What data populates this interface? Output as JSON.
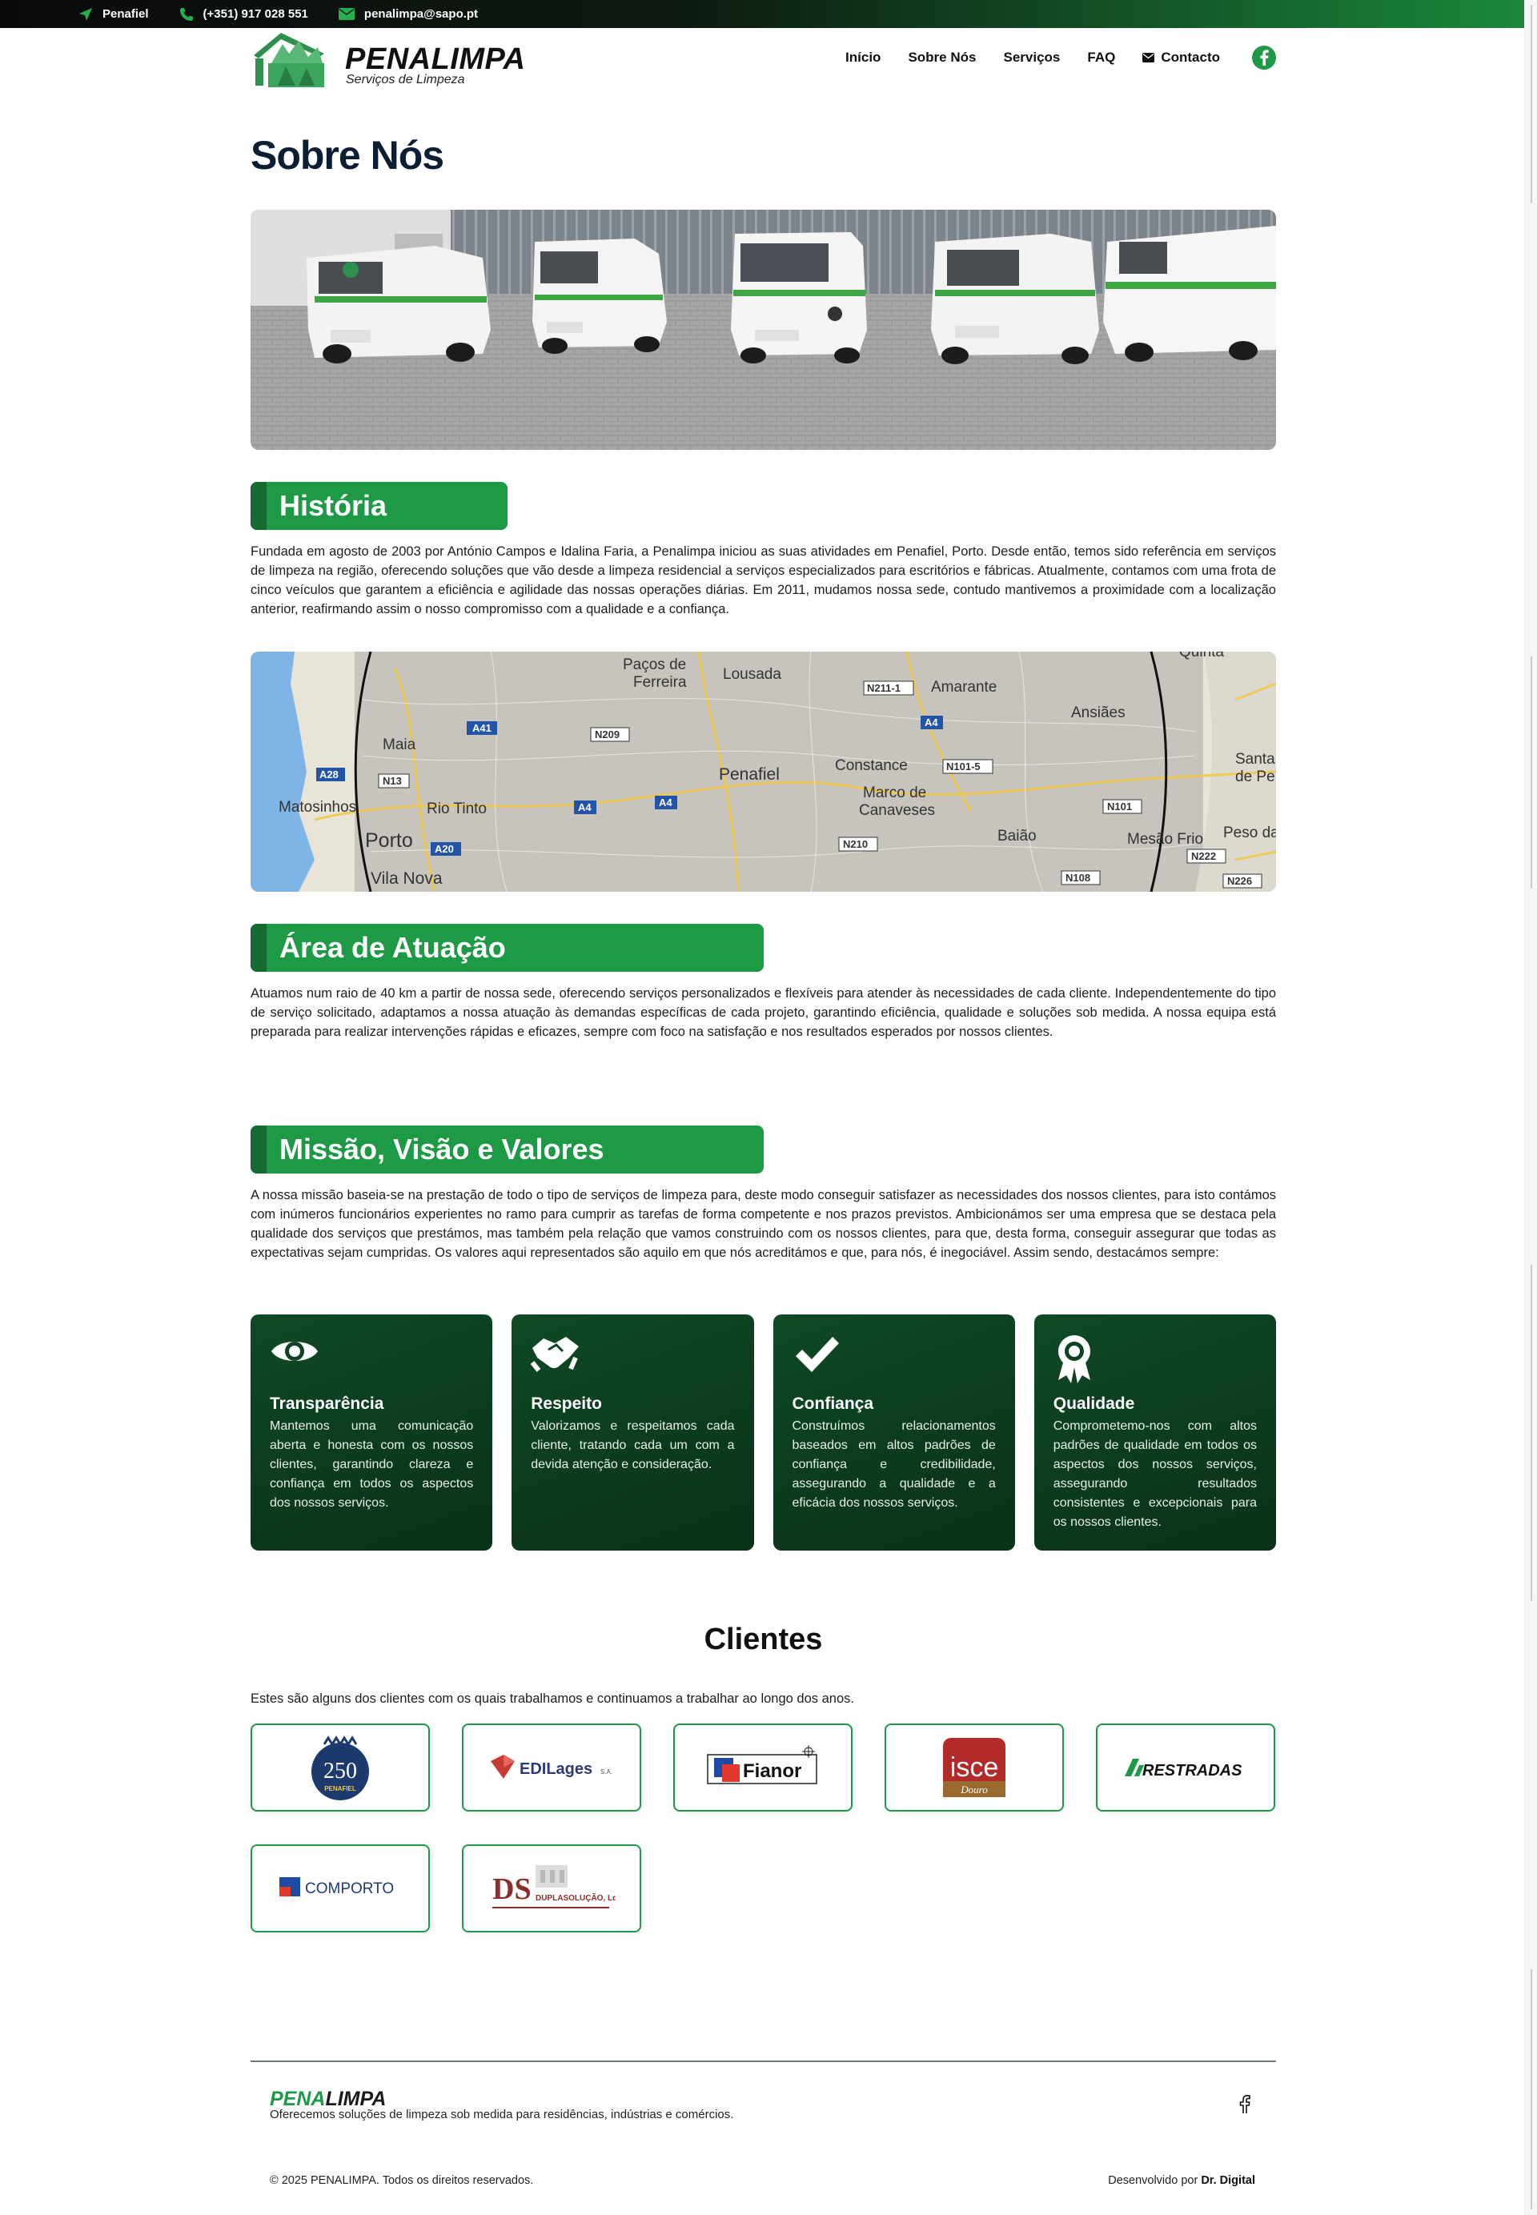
{
  "topbar": {
    "location": "Penafiel",
    "phone": "(+351) 917 028 551",
    "email": "penalimpa@sapo.pt"
  },
  "brand": {
    "name": "PENALIMPA",
    "subtitle": "Serviços de Limpeza",
    "accent": "#1e9a46",
    "dark_green": "#0b3a1d"
  },
  "nav": {
    "items": [
      "Início",
      "Sobre Nós",
      "Serviços",
      "FAQ"
    ],
    "contact": "Contacto",
    "facebook_icon": "facebook-icon"
  },
  "page": {
    "title": "Sobre Nós"
  },
  "history": {
    "heading": "História",
    "text": "Fundada em agosto de 2003 por António Campos e Idalina Faria, a Penalimpa iniciou as suas atividades em Penafiel, Porto. Desde então, temos sido referência em serviços de limpeza na região, oferecendo soluções que vão desde a limpeza residencial a serviços especializados para escritórios e fábricas. Atualmente, contamos com uma frota de cinco veículos que garantem a eficiência e agilidade das nossas operações diárias. Em 2011, mudamos nossa sede, contudo mantivemos a proximidade com a localização anterior, reafirmando assim o nosso compromisso com a qualidade e a confiança."
  },
  "map": {
    "places": [
      "Paços de Ferreira",
      "Lousada",
      "Amarante",
      "Quinta",
      "Maia",
      "Ansiães",
      "Penafiel",
      "Constance",
      "Marco de Canaveses",
      "Santa de Pe",
      "Matosinhos",
      "Rio Tinto",
      "Porto",
      "Baião",
      "Mesão Frio",
      "Peso da",
      "Vila Nova"
    ],
    "roads": [
      "A41",
      "N209",
      "N211-1",
      "A4",
      "A28",
      "N13",
      "N101-5",
      "A20",
      "N210",
      "N101",
      "N108",
      "N222",
      "N226"
    ]
  },
  "area": {
    "heading": "Área de Atuação",
    "text": "Atuamos num raio de 40 km a partir de nossa sede, oferecendo serviços personalizados e flexíveis para atender às necessidades de cada cliente. Independentemente do tipo de serviço solicitado, adaptamos a nossa atuação às demandas específicas de cada projeto, garantindo eficiência, qualidade e soluções sob medida. A nossa equipa está preparada para realizar intervenções rápidas e eficazes, sempre com foco na satisfação e nos resultados esperados por nossos clientes."
  },
  "mission": {
    "heading": "Missão, Visão e Valores",
    "text": "A nossa missão baseia-se na prestação de todo o tipo de serviços de limpeza para, deste modo conseguir satisfazer as necessidades dos nossos clientes, para isto contámos com inúmeros funcionários experientes no ramo para cumprir as tarefas de forma competente e nos prazos previstos. Ambicionámos ser uma empresa que se destaca pela qualidade dos serviços que prestámos, mas também pela relação que vamos construindo com os nossos clientes, para que, desta forma, conseguir assegurar que todas as expectativas sejam cumpridas. Os valores aqui representados são aquilo em que nós acreditámos e que, para nós, é inegociável. Assim sendo, destacámos sempre:"
  },
  "values": [
    {
      "icon": "eye-icon",
      "title": "Transparência",
      "text": "Mantemos uma comunicação aberta e honesta com os nossos clientes, garantindo clareza e confiança em todos os aspectos dos nossos serviços."
    },
    {
      "icon": "handshake-icon",
      "title": "Respeito",
      "text": "Valorizamos e respeitamos cada cliente, tratando cada um com a devida atenção e consideração."
    },
    {
      "icon": "check-icon",
      "title": "Confiança",
      "text": "Construímos relacionamentos baseados em altos padrões de confiança e credibilidade, assegurando a qualidade e a eficácia dos nossos serviços."
    },
    {
      "icon": "award-icon",
      "title": "Qualidade",
      "text": "Comprometemo-nos com altos padrões de qualidade em todos os aspectos dos nossos serviços, assegurando resultados consistentes e excepcionais para os nossos clientes."
    }
  ],
  "clients": {
    "heading": "Clientes",
    "intro": "Estes são alguns dos clientes com os quais trabalhamos e continuamos a trabalhar ao longo dos anos.",
    "logos": [
      {
        "name": "penafiel-250",
        "text_main": "250",
        "text_sub": "PENAFIEL"
      },
      {
        "name": "edilages",
        "text_main": "EDILages",
        "text_sub": "S.A."
      },
      {
        "name": "fianor",
        "text_main": "Fianor"
      },
      {
        "name": "isce-douro",
        "text_main": "isce",
        "text_sub": "Douro"
      },
      {
        "name": "restradas",
        "text_main": "RESTRADAS"
      },
      {
        "name": "comporto",
        "text_main": "COMPORTO"
      },
      {
        "name": "duplasolucao",
        "text_main": "DS",
        "text_sub": "DUPLASOLUÇÃO, Lda"
      }
    ]
  },
  "footer": {
    "brand_green": "PENA",
    "brand_dark": "LIMPA",
    "tagline": "Oferecemos soluções de limpeza sob medida para residências, indústrias e comércios.",
    "copyright": "© 2025 PENALIMPA. Todos os direitos reservados.",
    "dev_prefix": "Desenvolvido por",
    "dev_name": "Dr. Digital"
  }
}
